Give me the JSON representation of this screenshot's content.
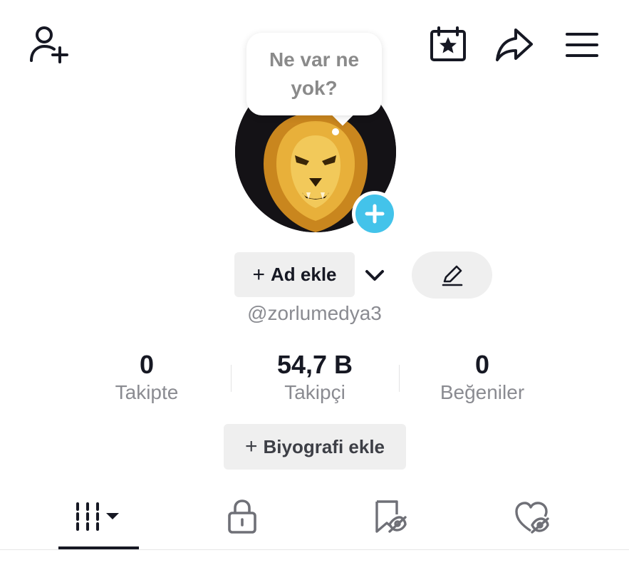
{
  "header": {
    "add_friend_icon": "person-add-icon",
    "calendar_icon": "calendar-star-icon",
    "share_icon": "share-arrow-icon",
    "menu_icon": "hamburger-menu-icon"
  },
  "bubble": {
    "text": "Ne var ne yok?"
  },
  "profile": {
    "name_button_label": "Ad ekle",
    "username": "@zorlumedya3",
    "accent_color": "#43c3ea"
  },
  "stats": [
    {
      "value": "0",
      "label": "Takipte"
    },
    {
      "value": "54,7 B",
      "label": "Takipçi"
    },
    {
      "value": "0",
      "label": "Beğeniler"
    }
  ],
  "bio_button_label": "Biyografi ekle",
  "tabs": [
    {
      "icon": "videos-grid-icon",
      "active": true
    },
    {
      "icon": "lock-icon",
      "active": false
    },
    {
      "icon": "bookmark-hidden-icon",
      "active": false
    },
    {
      "icon": "heart-hidden-icon",
      "active": false
    }
  ]
}
